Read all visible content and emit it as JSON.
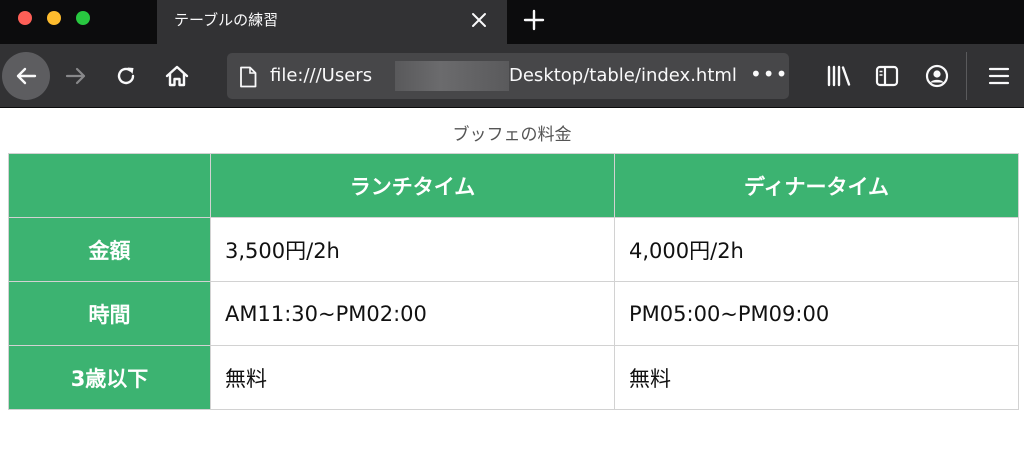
{
  "browser": {
    "tab_title": "テーブルの練習",
    "url_prefix": "file:///Users",
    "url_path": "Desktop/table/index.html",
    "url_more": "•••"
  },
  "page": {
    "caption": "ブッフェの料金",
    "table": {
      "headers": [
        "",
        "ランチタイム",
        "ディナータイム"
      ],
      "rows": [
        {
          "label": "金額",
          "lunch": "3,500円/2h",
          "dinner": "4,000円/2h"
        },
        {
          "label": "時間",
          "lunch": "AM11:30~PM02:00",
          "dinner": "PM05:00~PM09:00"
        },
        {
          "label": "3歳以下",
          "lunch": "無料",
          "dinner": "無料"
        }
      ]
    }
  },
  "colors": {
    "header_green": "#3cb371",
    "tabbar_bg": "#0c0c0d",
    "toolbar_bg": "#323234"
  },
  "icons": [
    "close-icon",
    "plus-icon",
    "back-arrow-icon",
    "forward-arrow-icon",
    "reload-icon",
    "home-icon",
    "page-icon",
    "library-icon",
    "sidebar-icon",
    "account-icon",
    "hamburger-menu-icon"
  ]
}
